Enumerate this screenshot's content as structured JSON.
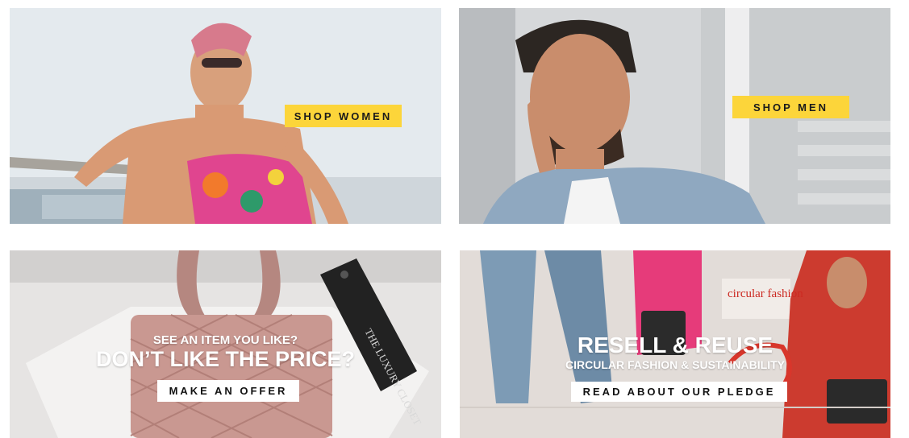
{
  "banners": {
    "women": {
      "button_label": "SHOP WOMEN"
    },
    "men": {
      "button_label": "SHOP MEN"
    },
    "offer": {
      "eyebrow": "SEE AN ITEM YOU LIKE?",
      "headline": "DON’T LIKE THE PRICE?",
      "button_label": "MAKE AN OFFER",
      "tag_text": "THE LUXURY CLOSET"
    },
    "resell": {
      "headline": "RESELL & REUSE",
      "subheadline": "CIRCULAR FASHION & SUSTAINABILITY",
      "button_label": "READ ABOUT OUR PLEDGE",
      "sticker_text": "circular fashion"
    }
  },
  "colors": {
    "accent_yellow": "#fcd53a",
    "white": "#ffffff",
    "text_dark": "#1b1b1b"
  }
}
